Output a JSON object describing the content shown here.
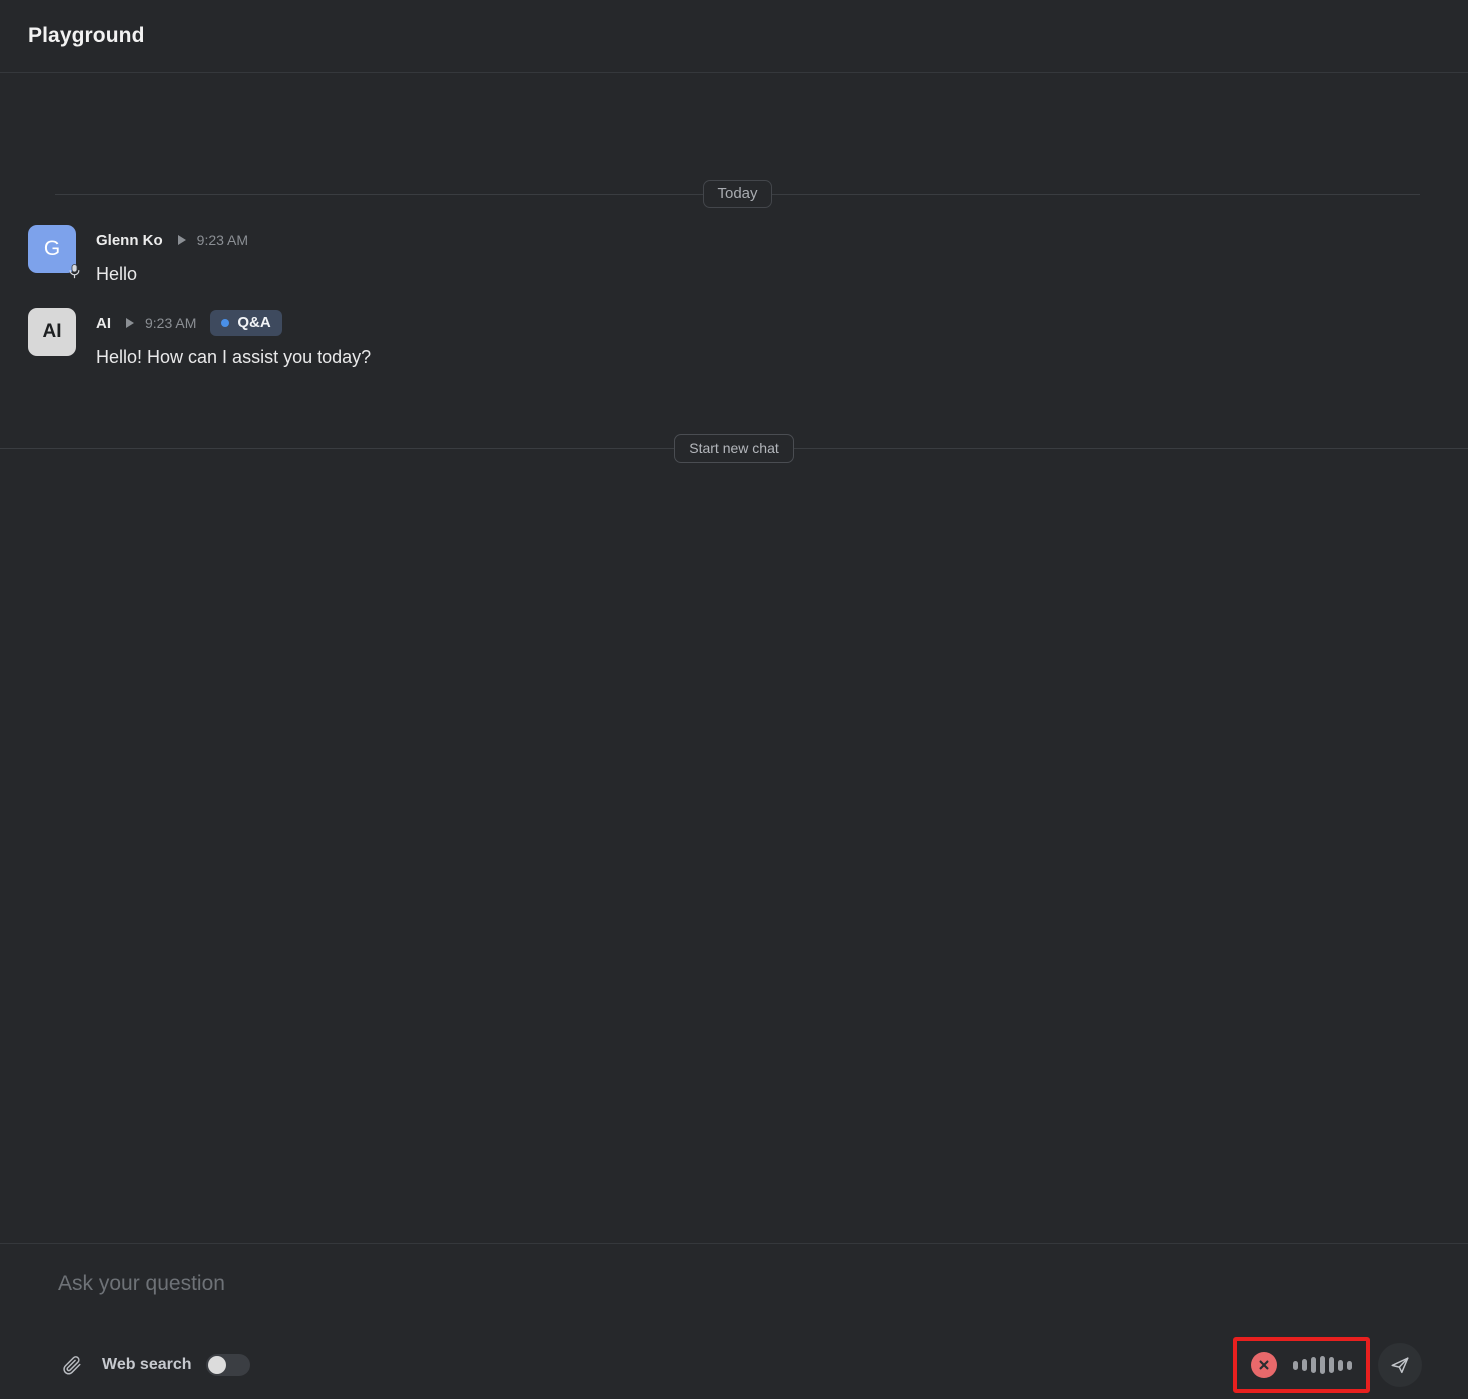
{
  "header": {
    "title": "Playground"
  },
  "chat": {
    "day_divider_label": "Today",
    "new_chat_label": "Start new chat",
    "messages": [
      {
        "author": "Glenn Ko",
        "avatar_initial": "G",
        "avatar_color": "#7da2eb",
        "time": "9:23 AM",
        "text": "Hello",
        "voice_input_icon": "microphone-icon",
        "badge": null
      },
      {
        "author": "AI",
        "avatar_initial": "AI",
        "avatar_color": "#d8d8d8",
        "time": "9:23 AM",
        "text": "Hello! How can I assist you today?",
        "voice_input_icon": null,
        "badge": {
          "label": "Q&A",
          "dot_color": "#4a90e8",
          "background": "#3e4a5e"
        }
      }
    ]
  },
  "composer": {
    "placeholder": "Ask your question",
    "value": "",
    "attachment_icon": "paperclip-icon",
    "web_search_label": "Web search",
    "web_search_enabled": false,
    "send_icon": "send-paper-plane-icon",
    "recorder": {
      "state": "recording",
      "cancel_icon": "circle-x-icon",
      "cancel_color": "#e8696b",
      "waveform_bars": [
        9,
        12,
        16,
        18,
        16,
        11,
        9
      ],
      "highlight_color": "#e8201f"
    }
  }
}
